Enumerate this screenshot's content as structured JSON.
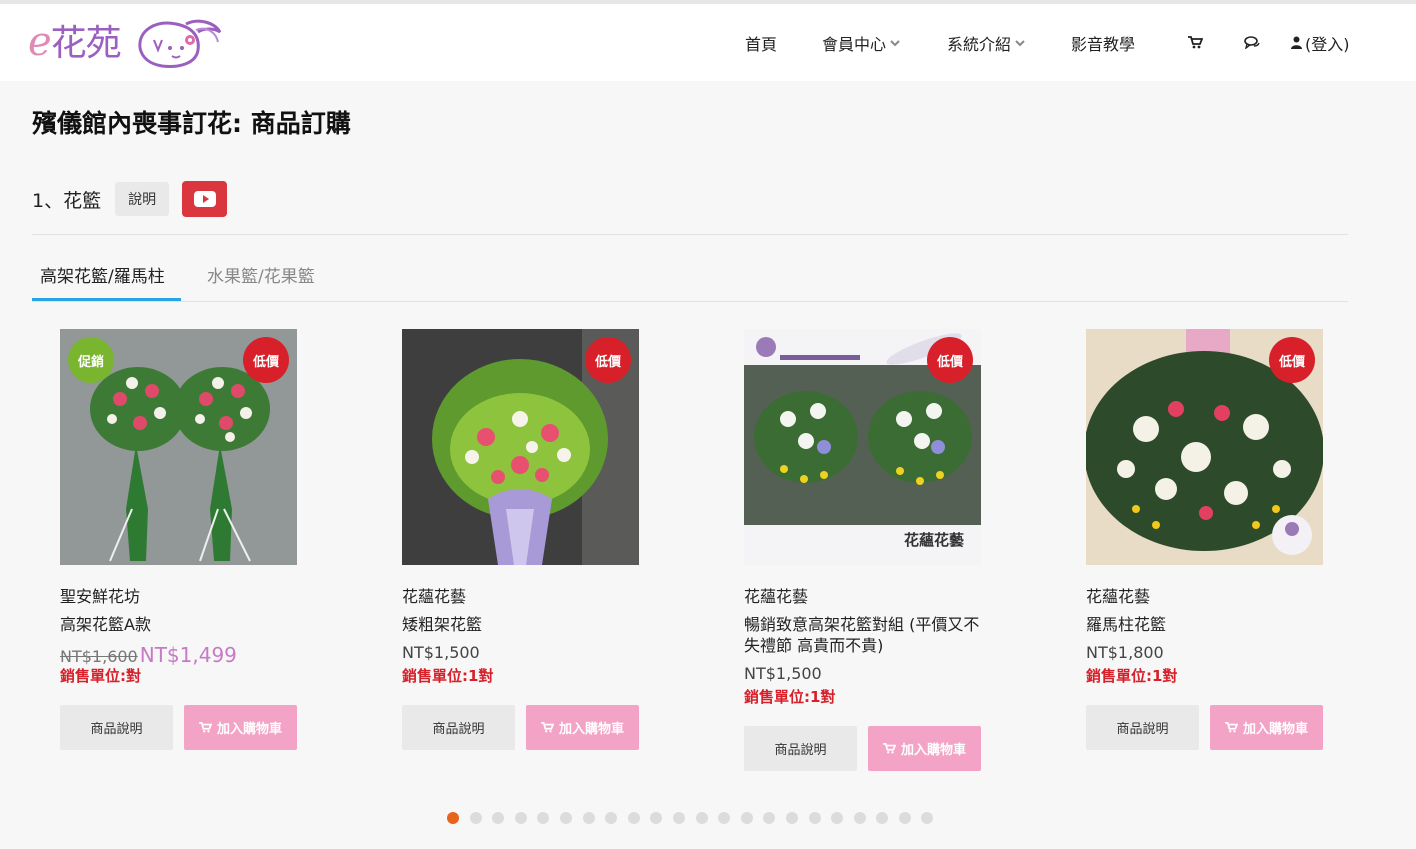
{
  "header": {
    "logo_text_e": "e",
    "logo_text": "花苑",
    "nav": [
      {
        "label": "首頁"
      },
      {
        "label": "會員中心"
      },
      {
        "label": "系統介紹"
      },
      {
        "label": "影音教學"
      }
    ],
    "login_label": "(登入)"
  },
  "page": {
    "title": "殯儀館內喪事訂花: 商品訂購",
    "section_label": "1、花籃",
    "desc_button": "說明"
  },
  "tabs": [
    {
      "label": "高架花籃/羅馬柱",
      "active": true
    },
    {
      "label": "水果籃/花果籃",
      "active": false
    }
  ],
  "products": [
    {
      "shop": "聖安鮮花坊",
      "name": "高架花籃A款",
      "old_price": "NT$1,600",
      "price": "NT$1,499",
      "unit": "銷售單位:對",
      "badges": {
        "sale": "促銷",
        "low": "低價"
      }
    },
    {
      "shop": "花蘊花藝",
      "name": "矮粗架花籃",
      "price": "NT$1,500",
      "unit": "銷售單位:1對",
      "badges": {
        "low": "低價"
      }
    },
    {
      "shop": "花蘊花藝",
      "name": "暢銷致意高架花籃對組 (平價又不失禮節 高貴而不貴)",
      "price": "NT$1,500",
      "unit": "銷售單位:1對",
      "badges": {
        "low": "低價"
      },
      "image_text": "花蘊花藝"
    },
    {
      "shop": "花蘊花藝",
      "name": "羅馬柱花籃",
      "price": "NT$1,800",
      "unit": "銷售單位:1對",
      "badges": {
        "low": "低價"
      }
    }
  ],
  "buttons": {
    "info": "商品說明",
    "cart": "加入購物車"
  },
  "pagination": {
    "total": 22,
    "active_index": 0
  },
  "colors": {
    "accent_blue": "#29a3e6",
    "youtube_red": "#d9363e",
    "badge_green": "#7ab530",
    "badge_red": "#d8202a",
    "cart_pink": "#f2a3c6",
    "sale_price": "#c879c6",
    "dot_active": "#e8631c"
  },
  "icons": [
    "cart-icon",
    "chat-icon",
    "user-icon",
    "youtube-icon",
    "chevron-down-icon"
  ]
}
